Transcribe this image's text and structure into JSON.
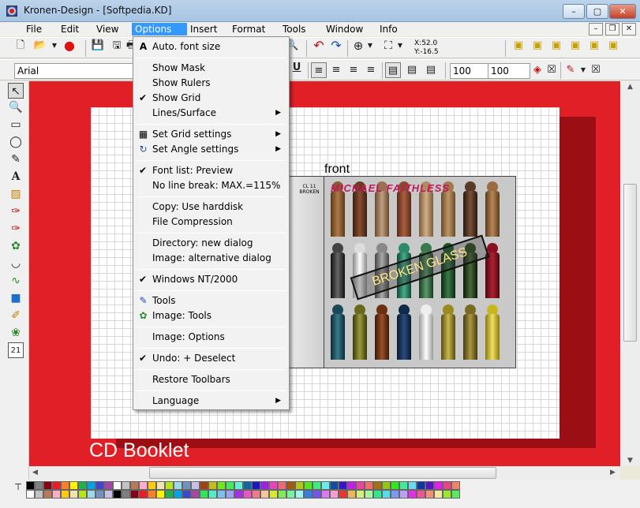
{
  "window": {
    "title": "Kronen-Design - [Softpedia.KD]",
    "minimize": "–",
    "maximize": "▢",
    "close": "✕"
  },
  "menubar": [
    "File",
    "Edit",
    "View",
    "Options",
    "Insert",
    "Format",
    "Tools",
    "Window",
    "Info"
  ],
  "mdi_controls": [
    "–",
    "❐",
    "✕"
  ],
  "toolbar": {
    "font_name": "Arial",
    "size_a": "100",
    "size_b": "100",
    "coord_x": "X:52.0",
    "coord_y": "Y:-16.5",
    "underline": "U"
  },
  "dropdown": {
    "items": [
      {
        "label": "Auto. font size",
        "check": "",
        "icon": "A",
        "submenu": false
      },
      {
        "label": "Show Mask",
        "check": "",
        "icon": "",
        "submenu": false
      },
      {
        "label": "Show Rulers",
        "check": "",
        "icon": "",
        "submenu": false
      },
      {
        "label": "Show Grid",
        "check": "✔",
        "icon": "",
        "submenu": false
      },
      {
        "label": "Lines/Surface",
        "check": "",
        "icon": "",
        "submenu": true
      },
      {
        "label": "Set Grid settings",
        "check": "",
        "icon": "▦",
        "submenu": true
      },
      {
        "label": "Set Angle settings",
        "check": "",
        "icon": "↻",
        "submenu": true
      },
      {
        "label": "Font list: Preview",
        "check": "✔",
        "icon": "",
        "submenu": false
      },
      {
        "label": "No line break: MAX.=115%",
        "check": "",
        "icon": "",
        "submenu": false
      },
      {
        "label": "Copy: Use harddisk",
        "check": "",
        "icon": "",
        "submenu": false
      },
      {
        "label": "File Compression",
        "check": "",
        "icon": "",
        "submenu": false
      },
      {
        "label": "Directory: new dialog",
        "check": "",
        "icon": "",
        "submenu": false
      },
      {
        "label": "Image: alternative dialog",
        "check": "",
        "icon": "",
        "submenu": false
      },
      {
        "label": "Windows NT/2000",
        "check": "✔",
        "icon": "",
        "submenu": false
      },
      {
        "label": "Tools",
        "check": "",
        "icon": "✎",
        "submenu": false
      },
      {
        "label": "Image: Tools",
        "check": "",
        "icon": "✿",
        "submenu": false
      },
      {
        "label": "Image: Options",
        "check": "",
        "icon": "",
        "submenu": false
      },
      {
        "label": "Undo: + Deselect",
        "check": "✔",
        "icon": "",
        "submenu": false
      },
      {
        "label": "Restore Toolbars",
        "check": "",
        "icon": "",
        "submenu": false
      },
      {
        "label": "Language",
        "check": "",
        "icon": "",
        "submenu": true
      }
    ],
    "submenu_arrow": "▶"
  },
  "canvas": {
    "page_label": "CD Booklet",
    "front_label": "front",
    "artist": "MICHAEL FAITHLESS",
    "album": "BROKEN GLASS",
    "back_text": "CL 11 BROKEN"
  },
  "colors": {
    "canvas_bg": "#e11f26",
    "menu_highlight": "#3399ff"
  }
}
